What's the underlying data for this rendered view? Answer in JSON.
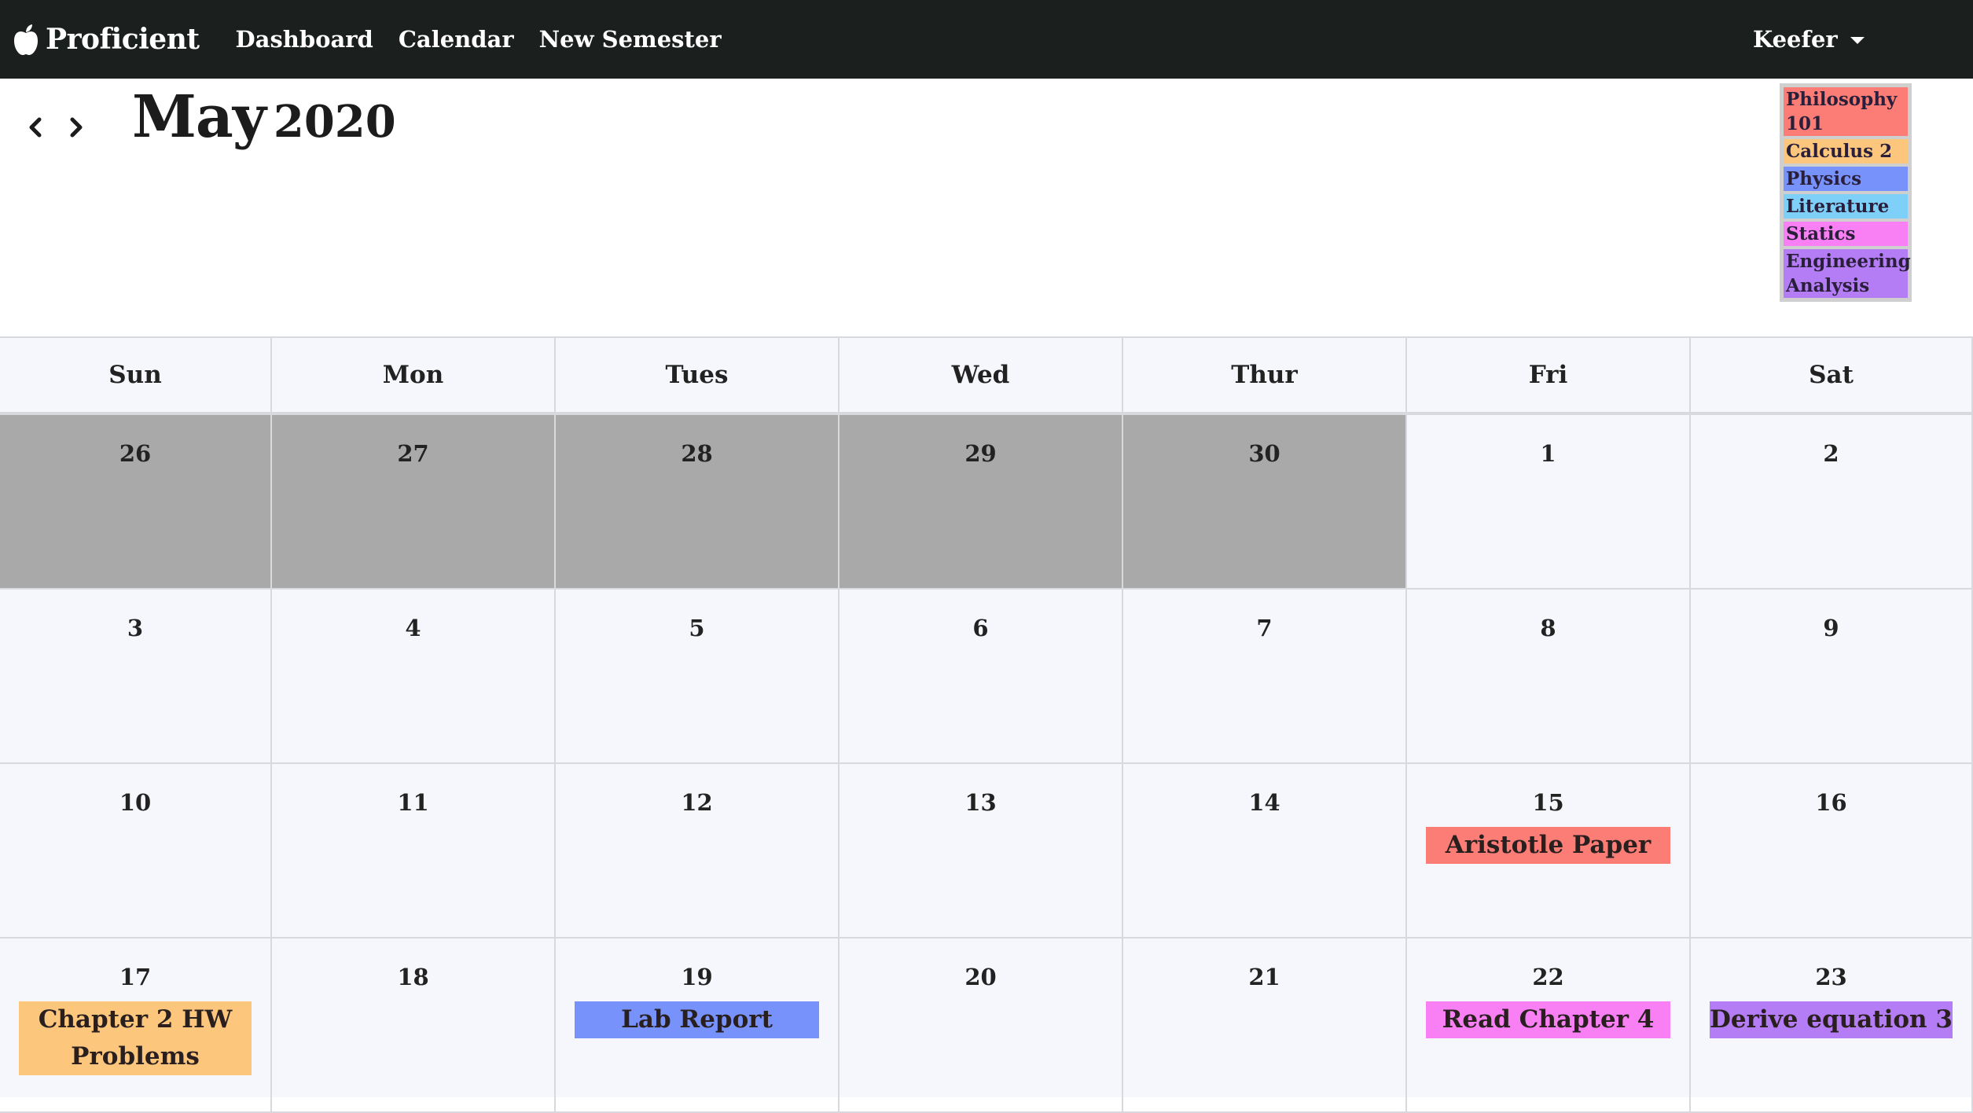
{
  "navbar": {
    "brand": "Proficient",
    "links": [
      "Dashboard",
      "Calendar",
      "New Semester"
    ],
    "user": "Keefer"
  },
  "header": {
    "month": "May",
    "year": "2020",
    "prev_icon": "chevron-left-icon",
    "next_icon": "chevron-right-icon"
  },
  "legend": [
    {
      "label": "Philosophy 101",
      "color": "#fb7d76"
    },
    {
      "label": "Calculus 2",
      "color": "#fdc67d"
    },
    {
      "label": "Physics",
      "color": "#7793fb"
    },
    {
      "label": "Literature",
      "color": "#7ed0f9"
    },
    {
      "label": "Statics",
      "color": "#f97ff4"
    },
    {
      "label": "Engineering Analysis",
      "color": "#b47cf5"
    }
  ],
  "weekdays": [
    "Sun",
    "Mon",
    "Tues",
    "Wed",
    "Thur",
    "Fri",
    "Sat"
  ],
  "weeks": [
    [
      {
        "day": "26",
        "outside": true
      },
      {
        "day": "27",
        "outside": true
      },
      {
        "day": "28",
        "outside": true
      },
      {
        "day": "29",
        "outside": true
      },
      {
        "day": "30",
        "outside": true
      },
      {
        "day": "1"
      },
      {
        "day": "2"
      }
    ],
    [
      {
        "day": "3"
      },
      {
        "day": "4"
      },
      {
        "day": "5"
      },
      {
        "day": "6"
      },
      {
        "day": "7"
      },
      {
        "day": "8"
      },
      {
        "day": "9"
      }
    ],
    [
      {
        "day": "10"
      },
      {
        "day": "11"
      },
      {
        "day": "12"
      },
      {
        "day": "13"
      },
      {
        "day": "14"
      },
      {
        "day": "15",
        "event": {
          "title": "Aristotle Paper",
          "color": "#fb7d76"
        }
      },
      {
        "day": "16"
      }
    ],
    [
      {
        "day": "17",
        "event": {
          "title": "Chapter 2 HW Problems",
          "color": "#fdc67d"
        }
      },
      {
        "day": "18"
      },
      {
        "day": "19",
        "event": {
          "title": "Lab Report",
          "color": "#7793fb"
        }
      },
      {
        "day": "20"
      },
      {
        "day": "21"
      },
      {
        "day": "22",
        "event": {
          "title": "Read Chapter 4",
          "color": "#f97ff4"
        }
      },
      {
        "day": "23",
        "event": {
          "title": "Derive equation 3",
          "color": "#b47cf5"
        }
      }
    ]
  ]
}
